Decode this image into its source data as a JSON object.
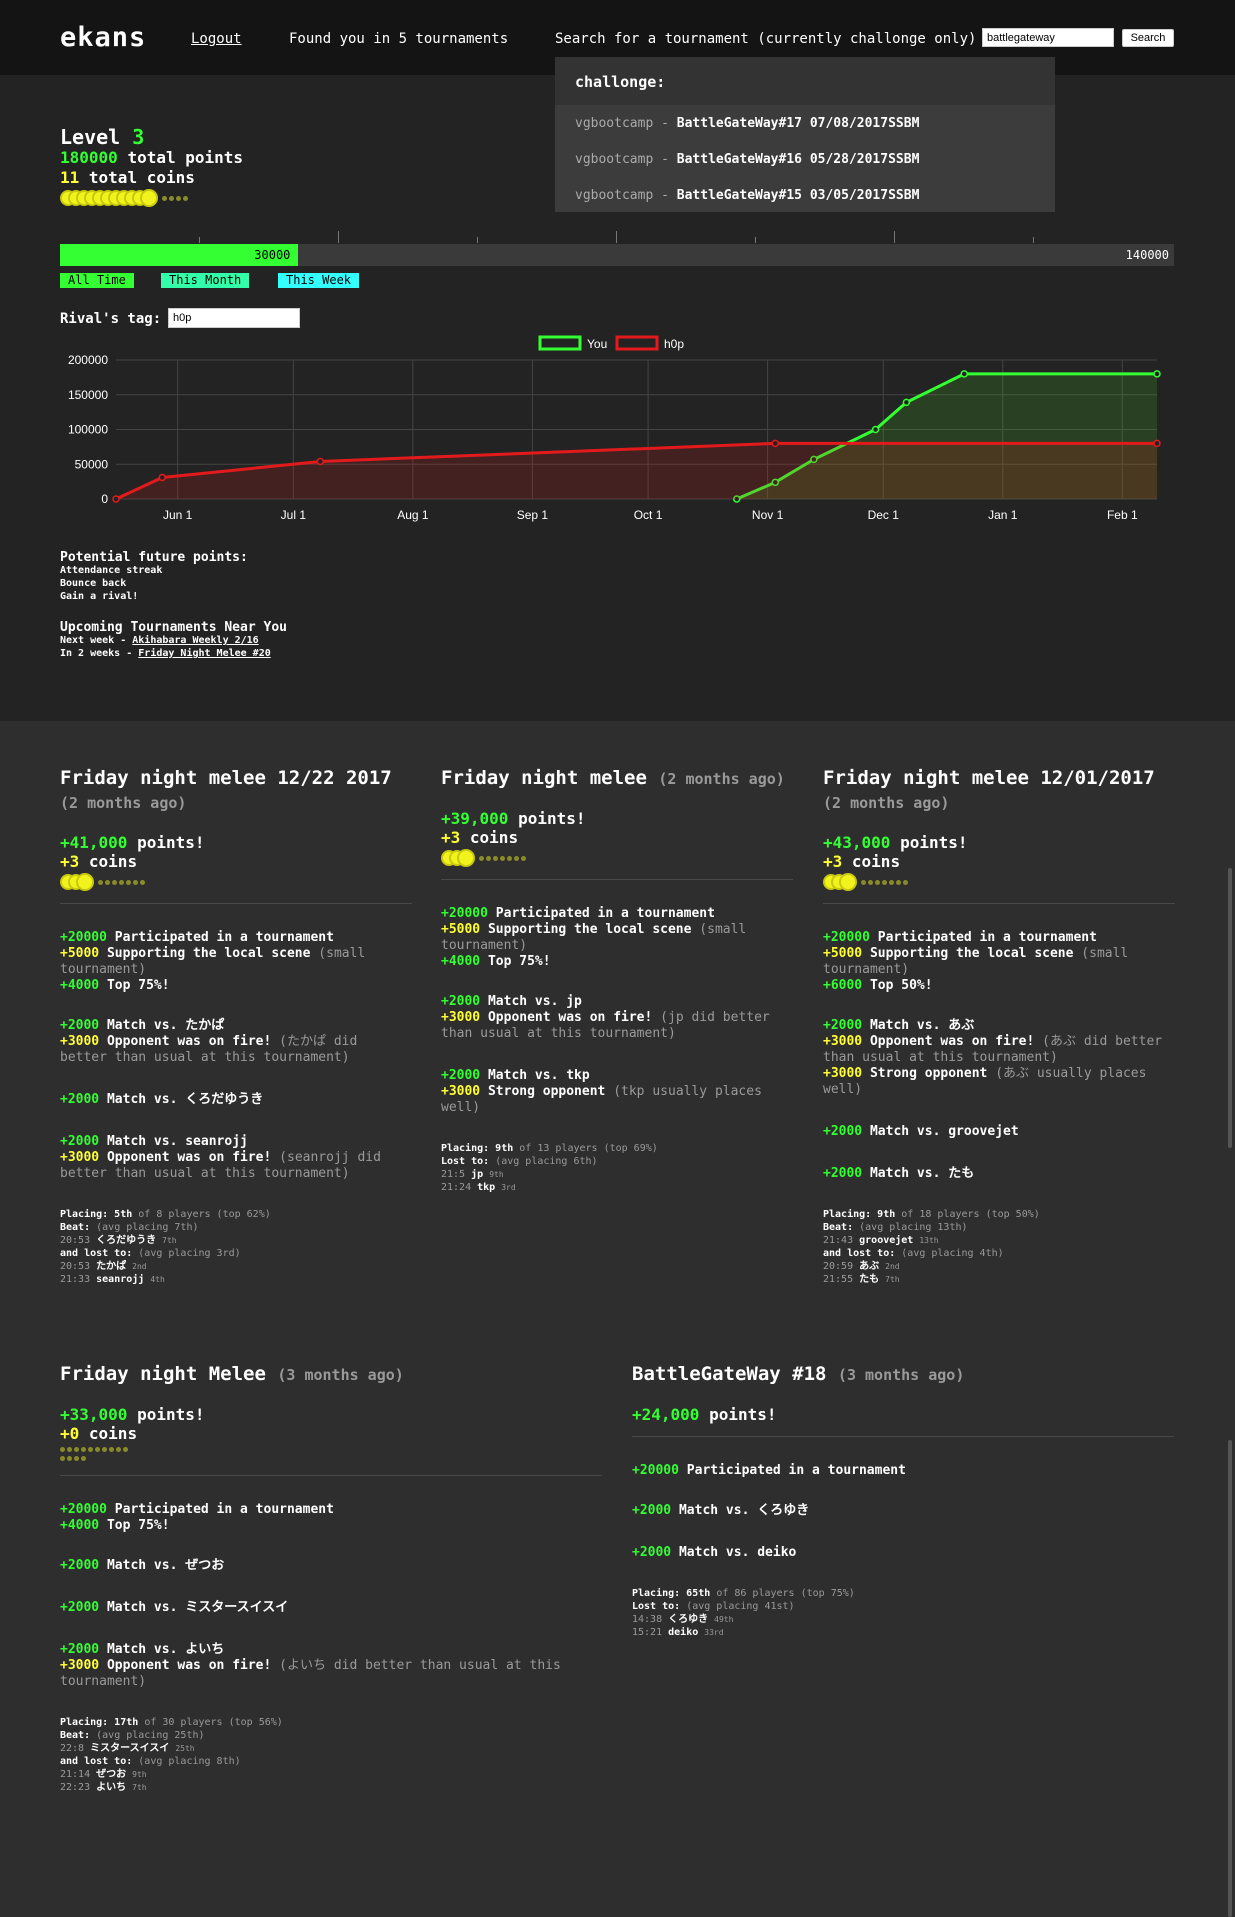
{
  "header": {
    "logo": "ekans",
    "logout": "Logout",
    "found": "Found you in 5 tournaments",
    "search_label": "Search for a tournament (currently challonge only)",
    "search_value": "battlegateway",
    "search_button": "Search"
  },
  "dropdown": {
    "heading": "challonge:",
    "items": [
      {
        "org": "vgbootcamp",
        "name": "BattleGateWay#17 07/08/2017SSBM"
      },
      {
        "org": "vgbootcamp",
        "name": "BattleGateWay#16 05/28/2017SSBM"
      },
      {
        "org": "vgbootcamp",
        "name": "BattleGateWay#15 03/05/2017SSBM"
      }
    ],
    "separator": "-"
  },
  "stats": {
    "level_label": "Level",
    "level": "3",
    "points": "180000",
    "points_label": "total points",
    "coins": "11",
    "coins_label": "total coins",
    "coins_filled": 11,
    "coins_empty": 4
  },
  "progress": {
    "value": "30000",
    "max": "140000",
    "fraction": 0.214
  },
  "time_filters": [
    {
      "label": "All Time",
      "color": "#33ff33"
    },
    {
      "label": "This Month",
      "color": "#33ffaa"
    },
    {
      "label": "This Week",
      "color": "#33ffff"
    }
  ],
  "rival": {
    "label": "Rival's tag:",
    "value": "h0p"
  },
  "chart_data": {
    "type": "line",
    "x_ticks": [
      "Jun 1",
      "Jul 1",
      "Aug 1",
      "Sep 1",
      "Oct 1",
      "Nov 1",
      "Dec 1",
      "Jan 1",
      "Feb 1"
    ],
    "y_ticks": [
      "0",
      "50000",
      "100000",
      "150000",
      "200000"
    ],
    "ylim": [
      0,
      200000
    ],
    "grid": true,
    "legend_position": "top-center",
    "series": [
      {
        "name": "You",
        "color": "#33ff33",
        "x": [
          "2017-10-24",
          "2017-11-03",
          "2017-11-13",
          "2017-11-29",
          "2017-12-07",
          "2017-12-22",
          "2018-02-10"
        ],
        "values": [
          0,
          24000,
          57000,
          100000,
          139000,
          180000,
          180000
        ]
      },
      {
        "name": "h0p",
        "color": "#e31a1c",
        "x": [
          "2017-05-16",
          "2017-05-28",
          "2017-07-08",
          "2017-11-03",
          "2018-02-10"
        ],
        "values": [
          0,
          31000,
          54000,
          80000,
          80000
        ]
      }
    ]
  },
  "future": {
    "title": "Potential future points:",
    "items": [
      "Attendance streak",
      "Bounce back",
      "Gain a rival!"
    ]
  },
  "upcoming": {
    "title": "Upcoming Tournaments Near You",
    "items": [
      {
        "when": "Next week -",
        "name": "Akihabara Weekly 2/16"
      },
      {
        "when": "In 2 weeks -",
        "name": "Friday Night Melee #20"
      }
    ]
  },
  "cards": [
    {
      "title": "Friday night melee 12/22 2017",
      "ago": "(2 months ago)",
      "points": "+41,000",
      "points_label": "points!",
      "coins": "+3",
      "coins_label": "coins",
      "coins_filled": 3,
      "coins_empty": 7,
      "groups": [
        [
          {
            "pts": "+20000",
            "text": "Participated in a tournament",
            "note": "",
            "color": "#33ff33"
          },
          {
            "pts": "+5000",
            "text": "Supporting the local scene",
            "note": "(small tournament)",
            "color": "#ffff33"
          },
          {
            "pts": "+4000",
            "text": "Top 75%!",
            "note": "",
            "color": "#33ff33"
          }
        ],
        [
          {
            "pts": "+2000",
            "text": "Match vs. たかぱ",
            "note": "",
            "color": "#33ff33"
          },
          {
            "pts": "+3000",
            "text": "Opponent was on fire!",
            "note": "(たかぱ did better than usual at this tournament)",
            "color": "#ffff33"
          }
        ],
        [
          {
            "pts": "+2000",
            "text": "Match vs. くろだゆうき",
            "note": "",
            "color": "#33ff33"
          }
        ],
        [
          {
            "pts": "+2000",
            "text": "Match vs. seanrojj",
            "note": "",
            "color": "#33ff33"
          },
          {
            "pts": "+3000",
            "text": "Opponent was on fire!",
            "note": "(seanrojj did better than usual at this tournament)",
            "color": "#ffff33"
          }
        ]
      ],
      "summary": [
        {
          "b": "Placing: 5th",
          "n": "of 8 players (top 62%)"
        },
        {
          "b": "Beat:",
          "n": "(avg placing 7th)"
        },
        {
          "t": "20:53",
          "b": "くろだゆうき",
          "s": "7th"
        },
        {
          "b": "and lost to:",
          "n": "(avg placing 3rd)"
        },
        {
          "t": "20:53",
          "b": "たかぱ",
          "s": "2nd"
        },
        {
          "t": "21:33",
          "b": "seanrojj",
          "s": "4th"
        }
      ]
    },
    {
      "title": "Friday night melee",
      "ago": "(2 months ago)",
      "points": "+39,000",
      "points_label": "points!",
      "coins": "+3",
      "coins_label": "coins",
      "coins_filled": 3,
      "coins_empty": 7,
      "groups": [
        [
          {
            "pts": "+20000",
            "text": "Participated in a tournament",
            "note": "",
            "color": "#33ff33"
          },
          {
            "pts": "+5000",
            "text": "Supporting the local scene",
            "note": "(small tournament)",
            "color": "#ffff33"
          },
          {
            "pts": "+4000",
            "text": "Top 75%!",
            "note": "",
            "color": "#33ff33"
          }
        ],
        [
          {
            "pts": "+2000",
            "text": "Match vs. jp",
            "note": "",
            "color": "#33ff33"
          },
          {
            "pts": "+3000",
            "text": "Opponent was on fire!",
            "note": "(jp did better than usual at this tournament)",
            "color": "#ffff33"
          }
        ],
        [
          {
            "pts": "+2000",
            "text": "Match vs. tkp",
            "note": "",
            "color": "#33ff33"
          },
          {
            "pts": "+3000",
            "text": "Strong opponent",
            "note": "(tkp usually places well)",
            "color": "#ffff33"
          }
        ]
      ],
      "summary": [
        {
          "b": "Placing: 9th",
          "n": "of 13 players (top 69%)"
        },
        {
          "b": "Lost to:",
          "n": "(avg placing 6th)"
        },
        {
          "t": "21:5",
          "b": "jp",
          "s": "9th"
        },
        {
          "t": "21:24",
          "b": "tkp",
          "s": "3rd"
        }
      ]
    },
    {
      "title": "Friday night melee 12/01/2017",
      "ago": "(2 months ago)",
      "points": "+43,000",
      "points_label": "points!",
      "coins": "+3",
      "coins_label": "coins",
      "coins_filled": 3,
      "coins_empty": 7,
      "groups": [
        [
          {
            "pts": "+20000",
            "text": "Participated in a tournament",
            "note": "",
            "color": "#33ff33"
          },
          {
            "pts": "+5000",
            "text": "Supporting the local scene",
            "note": "(small tournament)",
            "color": "#ffff33"
          },
          {
            "pts": "+6000",
            "text": "Top 50%!",
            "note": "",
            "color": "#33ff33"
          }
        ],
        [
          {
            "pts": "+2000",
            "text": "Match vs. あぶ",
            "note": "",
            "color": "#33ff33"
          },
          {
            "pts": "+3000",
            "text": "Opponent was on fire!",
            "note": "(あぶ did better than usual at this tournament)",
            "color": "#ffff33"
          },
          {
            "pts": "+3000",
            "text": "Strong opponent",
            "note": "(あぶ usually places well)",
            "color": "#ffff33"
          }
        ],
        [
          {
            "pts": "+2000",
            "text": "Match vs. groovejet",
            "note": "",
            "color": "#33ff33"
          }
        ],
        [
          {
            "pts": "+2000",
            "text": "Match vs. たも",
            "note": "",
            "color": "#33ff33"
          }
        ]
      ],
      "summary": [
        {
          "b": "Placing: 9th",
          "n": "of 18 players (top 50%)"
        },
        {
          "b": "Beat:",
          "n": "(avg placing 13th)"
        },
        {
          "t": "21:43",
          "b": "groovejet",
          "s": "13th"
        },
        {
          "b": "and lost to:",
          "n": "(avg placing 4th)"
        },
        {
          "t": "20:59",
          "b": "あぶ",
          "s": "2nd"
        },
        {
          "t": "21:55",
          "b": "たも",
          "s": "7th"
        }
      ]
    },
    {
      "title": "Friday night Melee",
      "ago": "(3 months ago)",
      "points": "+33,000",
      "points_label": "points!",
      "coins": "+0",
      "coins_label": "coins",
      "coins_filled": 0,
      "coins_empty": 14,
      "groups": [
        [
          {
            "pts": "+20000",
            "text": "Participated in a tournament",
            "note": "",
            "color": "#33ff33"
          },
          {
            "pts": "+4000",
            "text": "Top 75%!",
            "note": "",
            "color": "#33ff33"
          }
        ],
        [
          {
            "pts": "+2000",
            "text": "Match vs. ぜつお",
            "note": "",
            "color": "#33ff33"
          }
        ],
        [
          {
            "pts": "+2000",
            "text": "Match vs. ミスタースイスイ",
            "note": "",
            "color": "#33ff33"
          }
        ],
        [
          {
            "pts": "+2000",
            "text": "Match vs. よいち",
            "note": "",
            "color": "#33ff33"
          },
          {
            "pts": "+3000",
            "text": "Opponent was on fire!",
            "note": "(よいち did better than usual at this tournament)",
            "color": "#ffff33"
          }
        ]
      ],
      "summary": [
        {
          "b": "Placing: 17th",
          "n": "of 30 players (top 56%)"
        },
        {
          "b": "Beat:",
          "n": "(avg placing 25th)"
        },
        {
          "t": "22:8",
          "b": "ミスタースイスイ",
          "s": "25th"
        },
        {
          "b": "and lost to:",
          "n": "(avg placing 8th)"
        },
        {
          "t": "21:14",
          "b": "ぜつお",
          "s": "9th"
        },
        {
          "t": "22:23",
          "b": "よいち",
          "s": "7th"
        }
      ]
    },
    {
      "title": "BattleGateWay #18",
      "ago": "(3 months ago)",
      "points": "+24,000",
      "points_label": "points!",
      "coins": "",
      "coins_label": "",
      "coins_filled": 0,
      "coins_empty": 0,
      "groups": [
        [
          {
            "pts": "+20000",
            "text": "Participated in a tournament",
            "note": "",
            "color": "#33ff33"
          }
        ],
        [
          {
            "pts": "+2000",
            "text": "Match vs. くろゆき",
            "note": "",
            "color": "#33ff33"
          }
        ],
        [
          {
            "pts": "+2000",
            "text": "Match vs. deiko",
            "note": "",
            "color": "#33ff33"
          }
        ]
      ],
      "summary": [
        {
          "b": "Placing: 65th",
          "n": "of 86 players (top 75%)"
        },
        {
          "b": "Lost to:",
          "n": "(avg placing 41st)"
        },
        {
          "t": "14:38",
          "b": "くろゆき",
          "s": "49th"
        },
        {
          "t": "15:21",
          "b": "deiko",
          "s": "33rd"
        }
      ]
    }
  ]
}
